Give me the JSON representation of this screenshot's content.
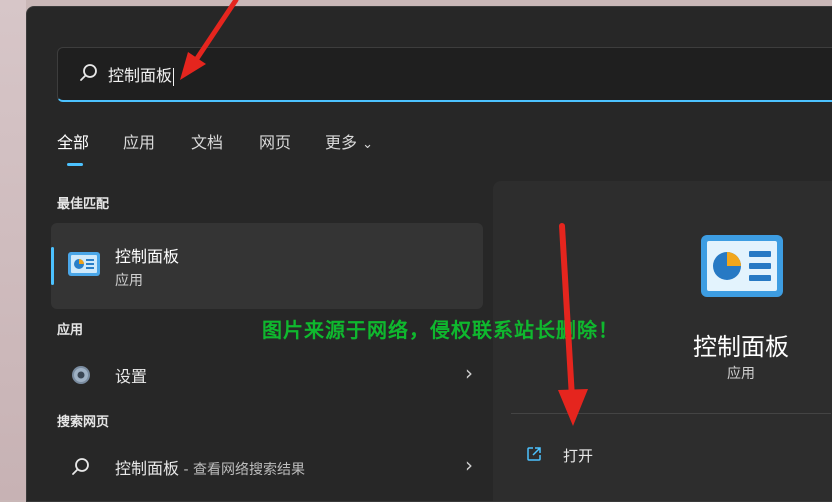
{
  "search": {
    "query": "控制面板"
  },
  "tabs": [
    {
      "label": "全部",
      "active": true
    },
    {
      "label": "应用"
    },
    {
      "label": "文档"
    },
    {
      "label": "网页"
    },
    {
      "label": "更多"
    }
  ],
  "sections": {
    "best_match": "最佳匹配",
    "apps": "应用",
    "web": "搜索网页"
  },
  "best_match": {
    "title": "控制面板",
    "subtitle": "应用",
    "icon": "control-panel-icon"
  },
  "apps": [
    {
      "label": "设置",
      "icon": "gear-icon"
    }
  ],
  "web": [
    {
      "label": "控制面板",
      "suffix": " - 查看网络搜索结果",
      "icon": "search-icon"
    }
  ],
  "preview": {
    "title": "控制面板",
    "subtitle": "应用",
    "open_label": "打开"
  },
  "watermark": "图片来源于网络，侵权联系站长删除！",
  "colors": {
    "accent": "#4cc2ff",
    "watermark": "#0fb82e",
    "arrow": "#e5251e"
  }
}
